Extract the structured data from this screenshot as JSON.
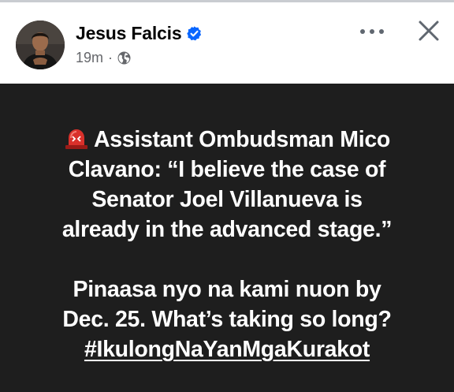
{
  "post": {
    "author": "Jesus Falcis",
    "verified_icon": "verified-badge-icon",
    "timestamp": "19m",
    "separator": "·",
    "privacy_icon": "globe-icon",
    "more_icon": "more-options-icon",
    "close_icon": "close-icon",
    "body": {
      "emoji_icon": "rotating-light-icon",
      "line1": "Assistant Ombudsman Mico",
      "line2": "Clavano: “I believe the case of",
      "line3": "Senator Joel Villanueva is",
      "line4": "already in the advanced stage.”",
      "line5": "Pinaasa nyo na kami nuon by",
      "line6": "Dec. 25. What’s taking so long?",
      "hashtag": "#IkulongNaYanMgaKurakot"
    }
  },
  "colors": {
    "background": "#ffffff",
    "post_background": "#1e1e1e",
    "post_text": "#ffffff",
    "name_text": "#050505",
    "meta_text": "#65676b",
    "verified_blue": "#0866ff"
  }
}
